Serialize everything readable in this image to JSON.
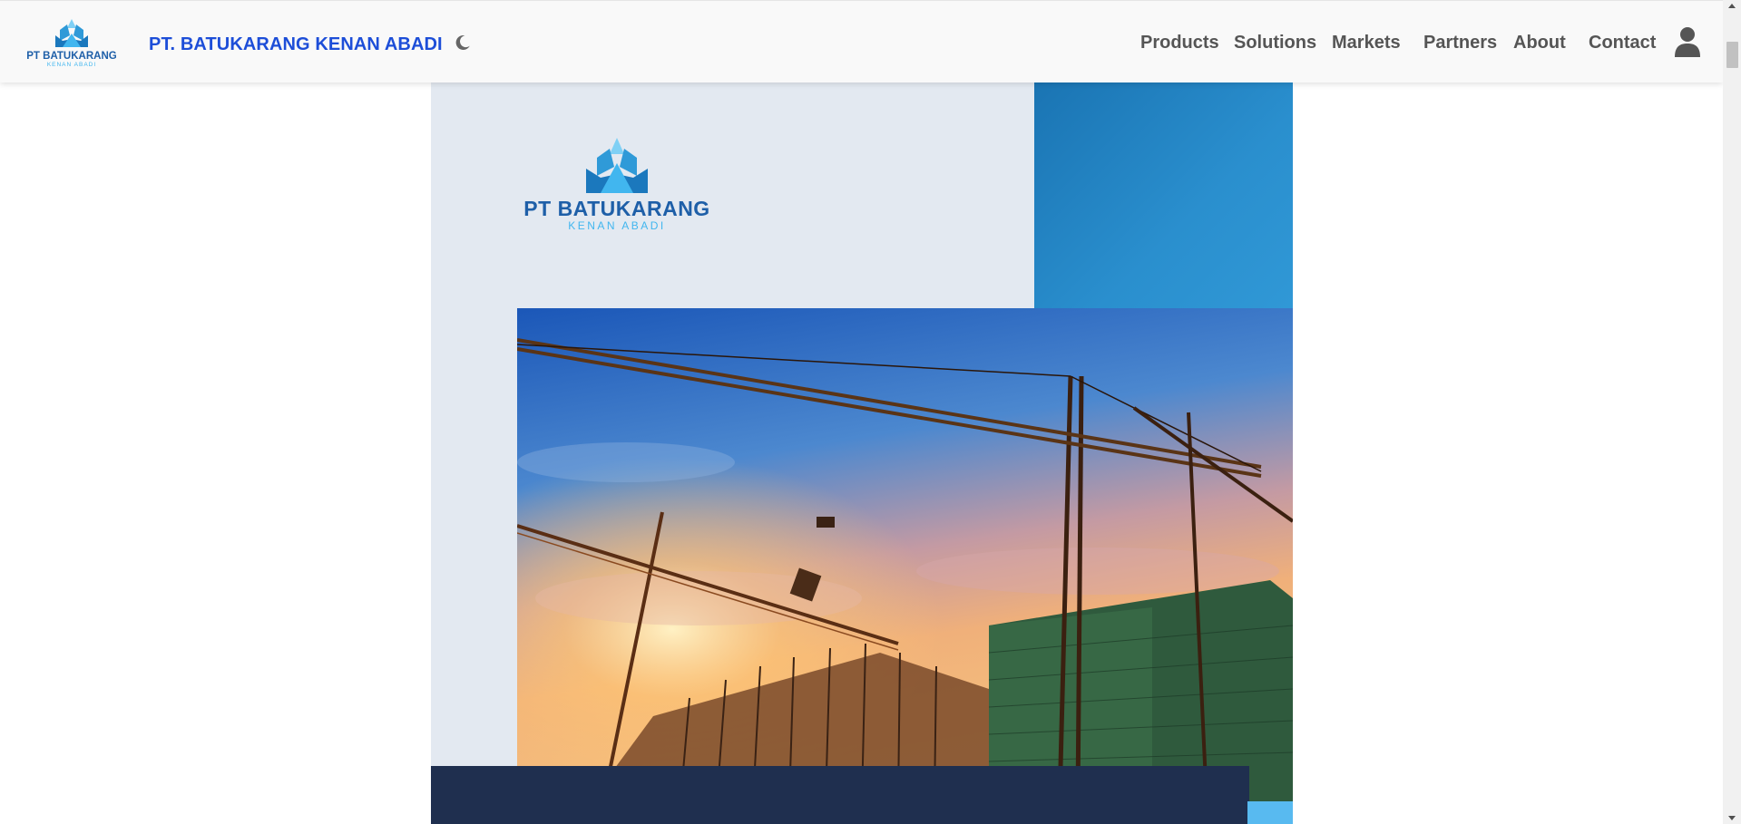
{
  "header": {
    "logo": {
      "line1": "PT BATUKARANG",
      "line2": "KENAN ABADI"
    },
    "brand_name": "PT. BATUKARANG KENAN ABADI",
    "theme_icon": "moon-icon",
    "nav": [
      {
        "label": "Products"
      },
      {
        "label": "Solutions"
      },
      {
        "label": "Markets"
      },
      {
        "label": "Partners"
      },
      {
        "label": "About"
      },
      {
        "label": "Contact"
      }
    ],
    "user_icon": "user-icon"
  },
  "hero": {
    "logo": {
      "line1": "PT BATUKARANG",
      "line2": "KENAN ABADI"
    },
    "image": "construction-cranes-sunset-photo"
  },
  "colors": {
    "brand_blue": "#1d4ed8",
    "logo_blue": "#1e88c9",
    "logo_light_blue": "#41b6ef",
    "panel": "#e3e9f1",
    "accent_blue": "#1a74b3",
    "dark_navy": "#1f2f4f"
  }
}
